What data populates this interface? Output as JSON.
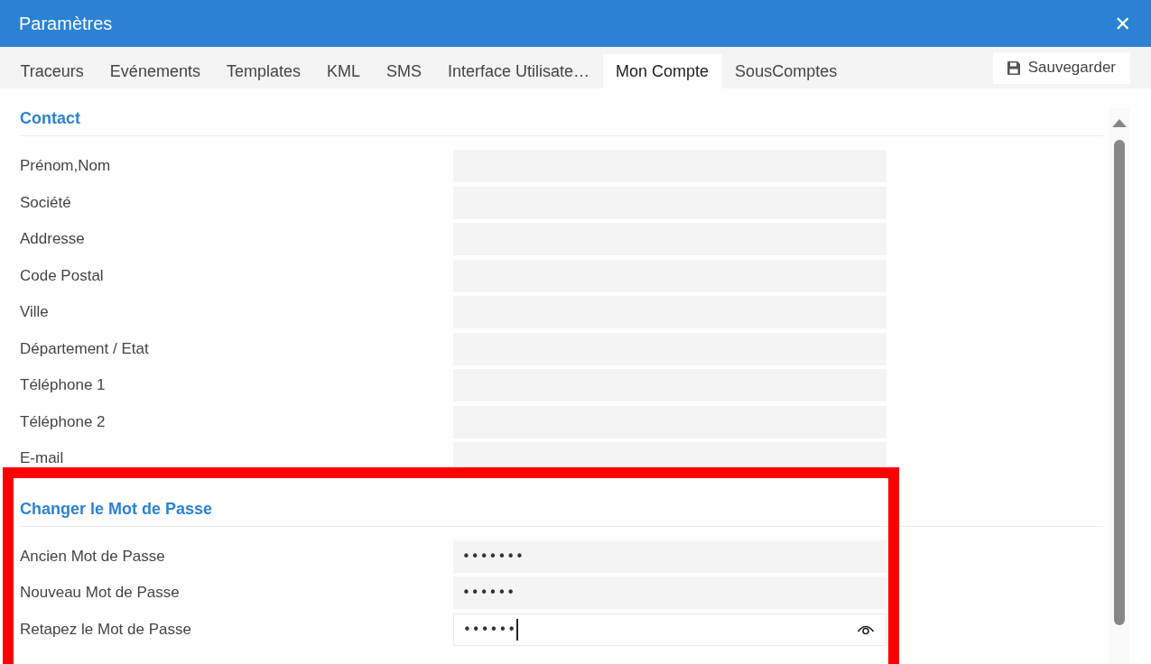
{
  "window": {
    "title": "Paramètres",
    "close": "✕"
  },
  "tabs": [
    {
      "label": "Traceurs",
      "selected": false
    },
    {
      "label": "Evénements",
      "selected": false
    },
    {
      "label": "Templates",
      "selected": false
    },
    {
      "label": "KML",
      "selected": false
    },
    {
      "label": "SMS",
      "selected": false
    },
    {
      "label": "Interface Utilisate…",
      "selected": false
    },
    {
      "label": "Mon Compte",
      "selected": true
    },
    {
      "label": "SousComptes",
      "selected": false
    }
  ],
  "save_button": {
    "label": "Sauvegarder"
  },
  "sections": [
    {
      "title": "Contact",
      "highlighted": false,
      "fields": [
        {
          "label": "Prénom,Nom",
          "kind": "text",
          "focused": false
        },
        {
          "label": "Société",
          "kind": "text",
          "focused": false
        },
        {
          "label": "Addresse",
          "kind": "text",
          "focused": false
        },
        {
          "label": "Code Postal",
          "kind": "text",
          "focused": false
        },
        {
          "label": "Ville",
          "kind": "text",
          "focused": false
        },
        {
          "label": "Département / Etat",
          "kind": "text",
          "focused": false
        },
        {
          "label": "Téléphone 1",
          "kind": "text",
          "focused": false
        },
        {
          "label": "Téléphone 2",
          "kind": "text",
          "focused": false
        },
        {
          "label": "E-mail",
          "kind": "text",
          "focused": false
        }
      ]
    },
    {
      "title": "Changer le Mot de Passe",
      "highlighted": true,
      "fields": [
        {
          "label": "Ancien Mot de Passe",
          "kind": "password",
          "value": "•••••••",
          "focused": false
        },
        {
          "label": "Nouveau Mot de Passe",
          "kind": "password",
          "value": "••••••",
          "focused": false
        },
        {
          "label": "Retapez le Mot de Passe",
          "kind": "password",
          "value": "••••••",
          "focused": true
        }
      ]
    }
  ]
}
